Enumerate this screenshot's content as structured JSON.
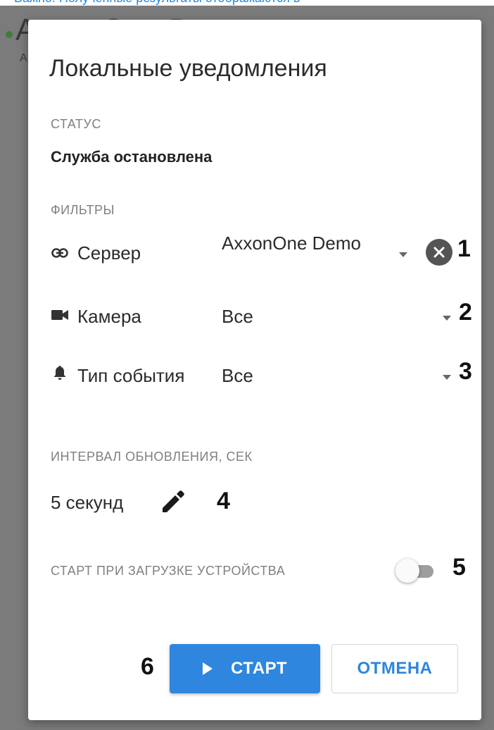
{
  "top_link": "Важно! Полученные результаты отображаются в",
  "background_app": {
    "title": "AxxonOne D",
    "subtitle": "A"
  },
  "dialog": {
    "title": "Локальные уведомления",
    "status": {
      "label": "СТАТУС",
      "value": "Служба остановлена"
    },
    "filters": {
      "label": "ФИЛЬТРЫ",
      "server": {
        "label": "Сервер",
        "value": "AxxonOne Demo",
        "icon": "link-icon"
      },
      "camera": {
        "label": "Камера",
        "value": "Все",
        "icon": "videocam-icon"
      },
      "event_type": {
        "label": "Тип события",
        "value": "Все",
        "icon": "bell-icon"
      }
    },
    "interval": {
      "label": "ИНТЕРВАЛ ОБНОВЛЕНИЯ, СЕК",
      "value": "5 секунд"
    },
    "autostart": {
      "label": "СТАРТ ПРИ ЗАГРУЗКЕ УСТРОЙСТВА",
      "enabled": false
    },
    "buttons": {
      "start": "СТАРТ",
      "cancel": "ОТМЕНА"
    }
  },
  "callouts": [
    "1",
    "2",
    "3",
    "4",
    "5",
    "6"
  ],
  "colors": {
    "accent": "#2e86de",
    "backdrop": "#7b7b7b",
    "clear_button": "#545454"
  }
}
